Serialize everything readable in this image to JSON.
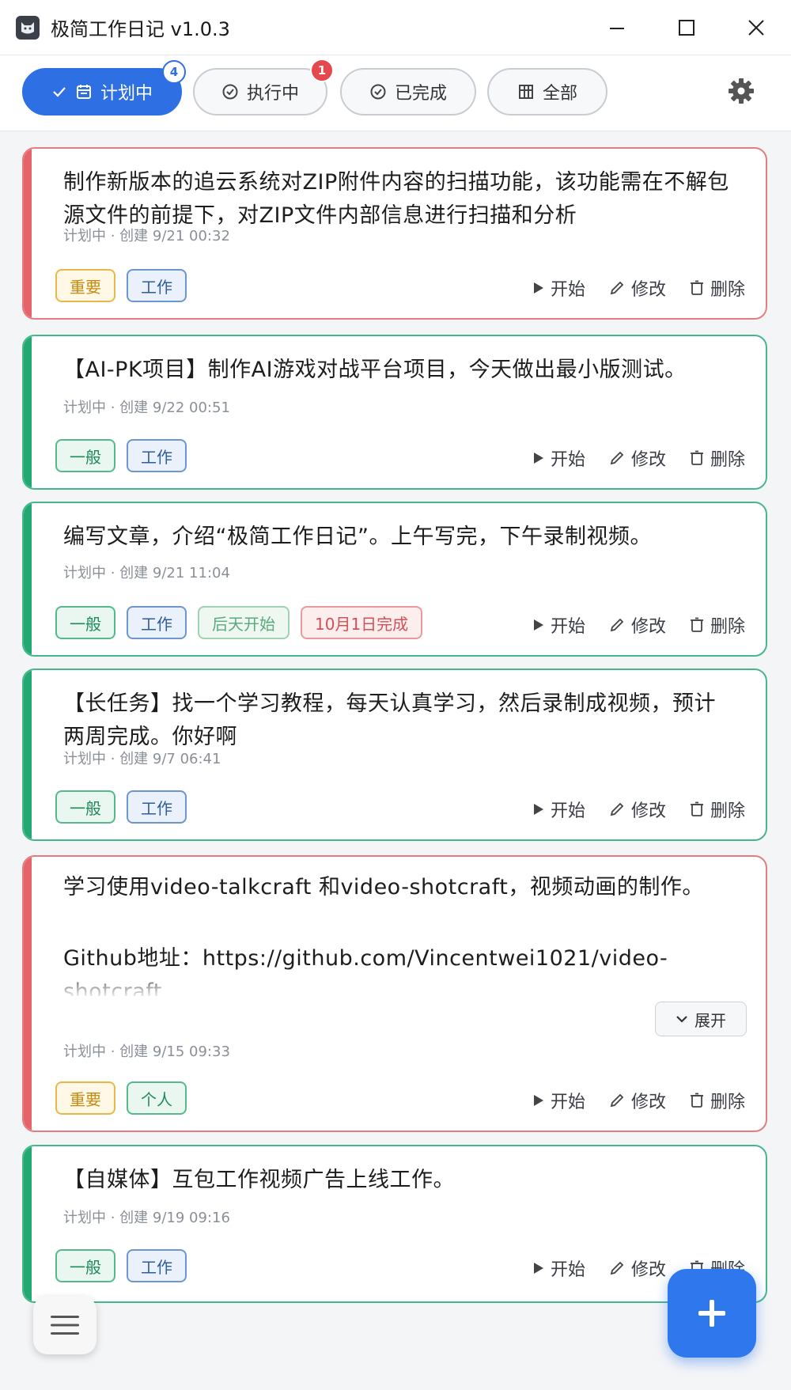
{
  "window": {
    "title": "极简工作日记 v1.0.3"
  },
  "tabs": [
    {
      "label": "计划中",
      "active": true,
      "badge": "4"
    },
    {
      "label": "执行中",
      "active": false,
      "badge": "1"
    },
    {
      "label": "已完成",
      "active": false
    },
    {
      "label": "全部",
      "active": false
    }
  ],
  "actions_labels": {
    "start": "开始",
    "edit": "修改",
    "delete": "删除"
  },
  "expand_label": "展开",
  "cards": [
    {
      "title": "制作新版本的追云系统对ZIP附件内容的扫描功能，该功能需在不解包源文件的前提下，对ZIP文件内部信息进行扫描和分析",
      "meta": "计划中 · 创建 9/21 00:32",
      "priority_color": "#e5646a",
      "tags": [
        "重要",
        "工作"
      ]
    },
    {
      "title": "【AI-PK项目】制作AI游戏对战平台项目，今天做出最小版测试。",
      "meta": "计划中 · 创建 9/22 00:51",
      "priority_color": "#22a871",
      "tags": [
        "一般",
        "工作"
      ]
    },
    {
      "title": "编写文章，介绍“极简工作日记”。上午写完，下午录制视频。",
      "meta": "计划中 · 创建 9/21 11:04",
      "priority_color": "#22a871",
      "tags": [
        "一般",
        "工作",
        "后天开始",
        "10月1日完成"
      ]
    },
    {
      "title": "【长任务】找一个学习教程，每天认真学习，然后录制成视频，预计两周完成。你好啊",
      "meta": "计划中 · 创建 9/7 06:41",
      "priority_color": "#22a871",
      "tags": [
        "一般",
        "工作"
      ]
    },
    {
      "title_line1": "学习使用video-talkcraft 和video-shotcraft，视频动画的制作。",
      "title_line2": "Github地址：https://github.com/Vincentwei1021/video-",
      "title_line3": "shotcraft",
      "meta": "计划中 · 创建 9/15 09:33",
      "priority_color": "#e5646a",
      "tags": [
        "重要",
        "个人"
      ]
    },
    {
      "title": "【自媒体】互包工作视频广告上线工作。",
      "meta": "计划中 · 创建 9/19 09:16",
      "priority_color": "#22a871",
      "tags": [
        "一般",
        "工作"
      ]
    }
  ],
  "icons": {
    "app": "cat-logo-icon",
    "settings": "gear-icon",
    "menu": "hamburger-menu-icon",
    "add": "plus-icon"
  },
  "colors": {
    "accent": "#2f6fe4",
    "important": "#e5646a",
    "normal": "#22a871",
    "badge_red": "#e5484d"
  }
}
